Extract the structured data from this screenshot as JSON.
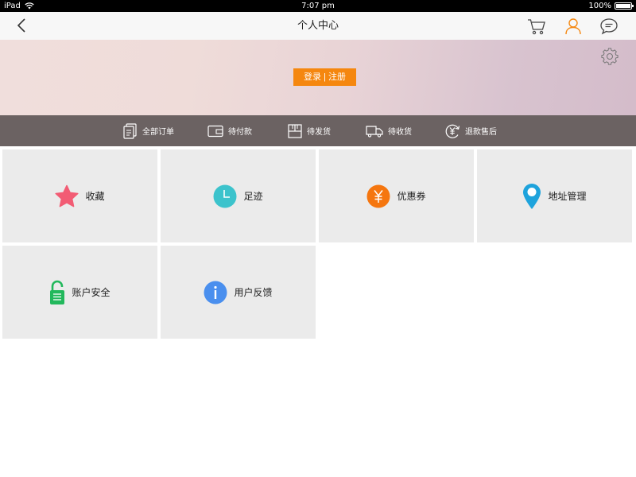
{
  "status_bar": {
    "device": "iPad",
    "time": "7:07 pm",
    "battery": "100%"
  },
  "nav": {
    "title": "个人中心"
  },
  "banner": {
    "login_label": "登录 | 注册"
  },
  "orders": [
    {
      "label": "全部订单",
      "icon": "all-orders-icon"
    },
    {
      "label": "待付款",
      "icon": "wallet-icon"
    },
    {
      "label": "待发货",
      "icon": "package-icon"
    },
    {
      "label": "待收货",
      "icon": "truck-icon"
    },
    {
      "label": "退款售后",
      "icon": "refund-icon"
    }
  ],
  "tiles": [
    {
      "label": "收藏",
      "icon": "star-icon",
      "color": "#f25c74"
    },
    {
      "label": "足迹",
      "icon": "clock-icon",
      "color": "#3cc3cc"
    },
    {
      "label": "优惠券",
      "icon": "yen-coupon-icon",
      "color": "#f5760f"
    },
    {
      "label": "地址管理",
      "icon": "location-pin-icon",
      "color": "#1ea3dc"
    },
    {
      "label": "账户安全",
      "icon": "unlock-icon",
      "color": "#22b85c"
    },
    {
      "label": "用户反馈",
      "icon": "info-icon",
      "color": "#4a8fee"
    }
  ],
  "colors": {
    "accent": "#f5870f",
    "order_bar": "#6b6262",
    "tile_bg": "#ebebeb"
  }
}
